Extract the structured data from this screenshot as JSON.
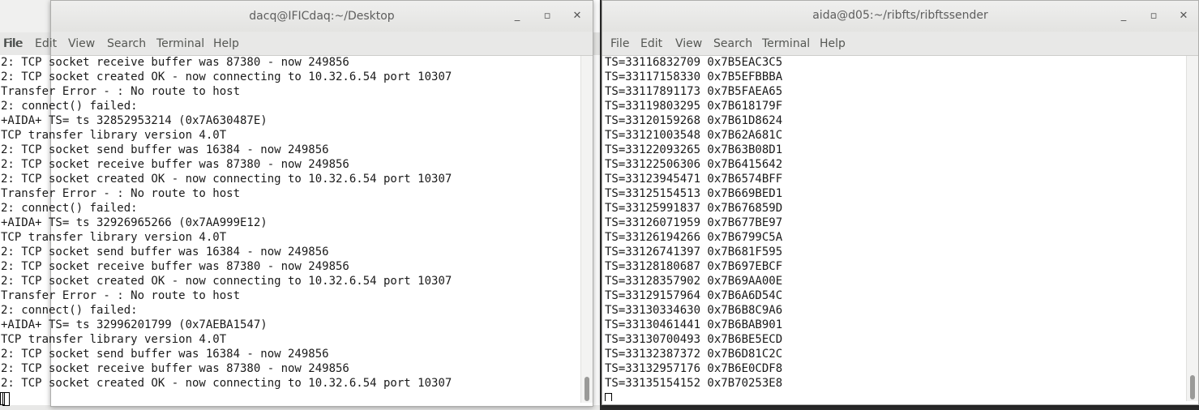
{
  "back_window": {
    "menu": [
      "File",
      "Edit",
      "View",
      "Search",
      "Terminal",
      "Help"
    ]
  },
  "left_window": {
    "title": "dacq@IFICdaq:~/Desktop",
    "controls": {
      "minimize": "_",
      "maximize": "▫",
      "close": "✕"
    },
    "menu": [
      "File",
      "Edit",
      "View",
      "Search",
      "Terminal",
      "Help"
    ],
    "lines": [
      "2: TCP socket receive buffer was 87380 - now 249856",
      "2: TCP socket created OK - now connecting to 10.32.6.54 port 10307",
      "Transfer Error - : No route to host",
      "2: connect() failed:",
      "+AIDA+ TS= ts 32852953214 (0x7A630487E)",
      "TCP transfer library version 4.0T",
      "2: TCP socket send buffer was 16384 - now 249856",
      "2: TCP socket receive buffer was 87380 - now 249856",
      "2: TCP socket created OK - now connecting to 10.32.6.54 port 10307",
      "Transfer Error - : No route to host",
      "2: connect() failed:",
      "+AIDA+ TS= ts 32926965266 (0x7AA999E12)",
      "TCP transfer library version 4.0T",
      "2: TCP socket send buffer was 16384 - now 249856",
      "2: TCP socket receive buffer was 87380 - now 249856",
      "2: TCP socket created OK - now connecting to 10.32.6.54 port 10307",
      "Transfer Error - : No route to host",
      "2: connect() failed:",
      "+AIDA+ TS= ts 32996201799 (0x7AEBA1547)",
      "TCP transfer library version 4.0T",
      "2: TCP socket send buffer was 16384 - now 249856",
      "2: TCP socket receive buffer was 87380 - now 249856",
      "2: TCP socket created OK - now connecting to 10.32.6.54 port 10307"
    ]
  },
  "right_window": {
    "title": "aida@d05:~/ribfts/ribftssender",
    "controls": {
      "minimize": "_",
      "maximize": "▫",
      "close": "✕"
    },
    "menu": [
      "File",
      "Edit",
      "View",
      "Search",
      "Terminal",
      "Help"
    ],
    "lines": [
      "TS=33116832709 0x7B5EAC3C5",
      "TS=33117158330 0x7B5EFBBBA",
      "TS=33117891173 0x7B5FAEA65",
      "TS=33119803295 0x7B618179F",
      "TS=33120159268 0x7B61D8624",
      "TS=33121003548 0x7B62A681C",
      "TS=33122093265 0x7B63B08D1",
      "TS=33122506306 0x7B6415642",
      "TS=33123945471 0x7B6574BFF",
      "TS=33125154513 0x7B669BED1",
      "TS=33125991837 0x7B676859D",
      "TS=33126071959 0x7B677BE97",
      "TS=33126194266 0x7B6799C5A",
      "TS=33126741397 0x7B681F595",
      "TS=33128180687 0x7B697EBCF",
      "TS=33128357902 0x7B69AA00E",
      "TS=33129157964 0x7B6A6D54C",
      "TS=33130334630 0x7B6B8C9A6",
      "TS=33130461441 0x7B6BAB901",
      "TS=33130700493 0x7B6BE5ECD",
      "TS=33132387372 0x7B6D81C2C",
      "TS=33132957176 0x7B6E0CDF8",
      "TS=33135154152 0x7B70253E8"
    ]
  }
}
